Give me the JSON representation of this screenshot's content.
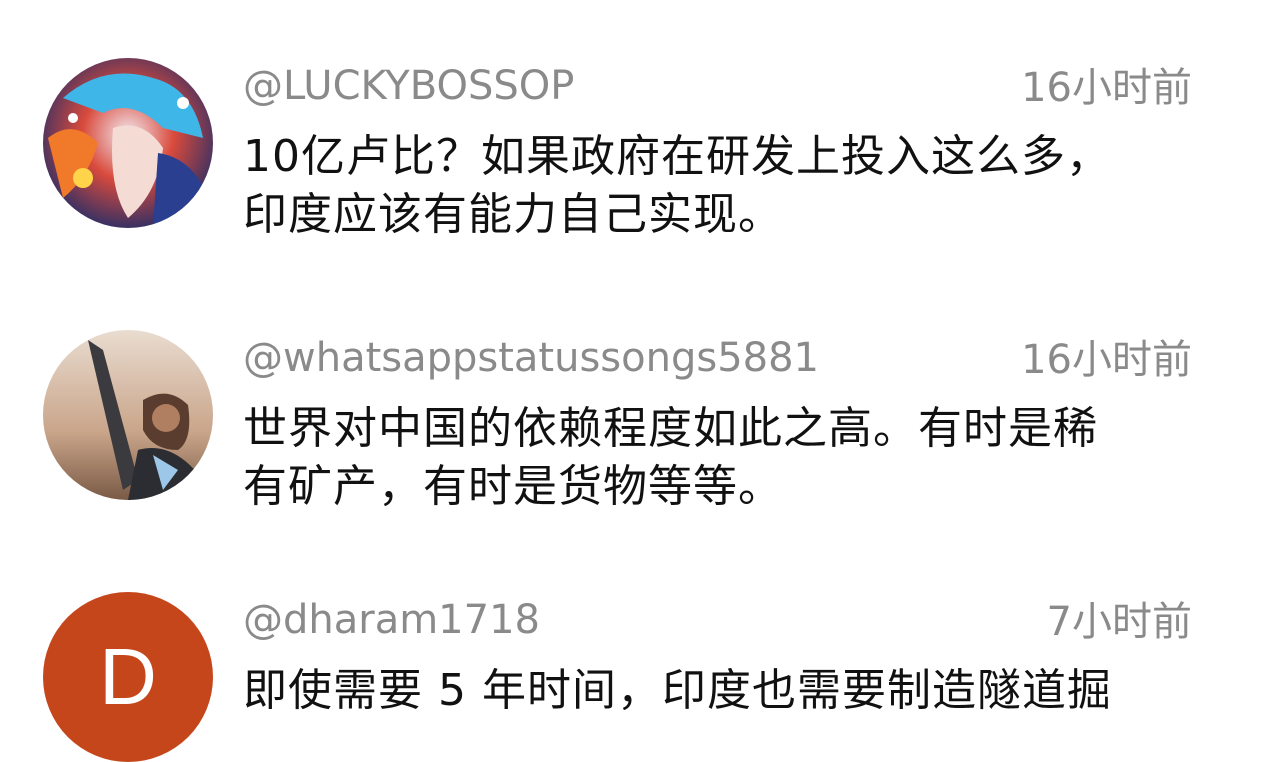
{
  "comments": [
    {
      "username": "@LUCKYBOSSOP",
      "time": "16小时前",
      "avatar": "anime-character-avatar",
      "lines": [
        "10亿卢比？如果政府在研发上投入这么多，",
        "印度应该有能力自己实现。"
      ]
    },
    {
      "username": "@whatsappstatussongs5881",
      "time": "16小时前",
      "avatar": "hero-character-avatar",
      "lines": [
        "世界对中国的依赖程度如此之高。有时是稀",
        "有矿产，有时是货物等等。"
      ]
    },
    {
      "username": "@dharam1718",
      "time": "7小时前",
      "avatar_letter": "D",
      "avatar_color": "#c6461c",
      "lines": [
        "即使需要 5 年时间，印度也需要制造隧道掘"
      ]
    }
  ],
  "colors": {
    "meta_text": "#8a8a8a",
    "body_text": "#111111",
    "background": "#ffffff"
  }
}
